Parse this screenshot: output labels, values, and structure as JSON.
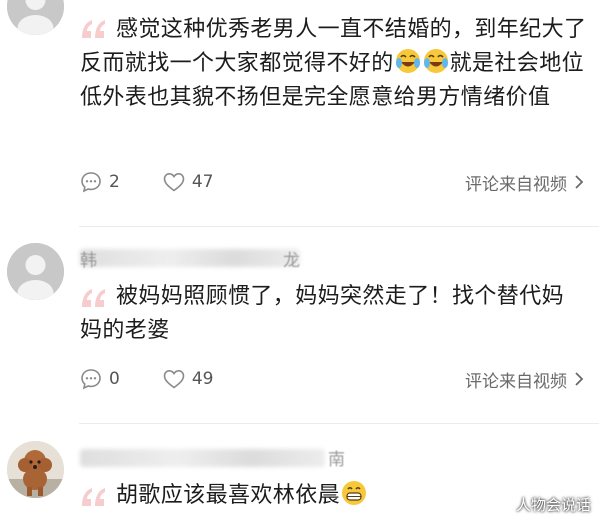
{
  "comments": [
    {
      "text": "感觉这种优秀老男人一直不结婚的，到年纪大了反而就找一个大家都觉得不好的",
      "text_after_emoji": "就是社会地位低外表也其貌不扬但是完全愿意给男方情绪价值",
      "reply_count": "2",
      "like_count": "47",
      "source": "评论来自视频"
    },
    {
      "name_first_char": "韩",
      "name_last_char": "龙",
      "text": "被妈妈照顾惯了，妈妈突然走了！找个替代妈妈的老婆",
      "reply_count": "0",
      "like_count": "49",
      "source": "评论来自视频"
    },
    {
      "name_last_char": "南",
      "text": "胡歌应该最喜欢林依晨"
    }
  ],
  "watermark": "人物会说话",
  "colors": {
    "quote": "#f5c9c9",
    "icon": "#8a8a8a",
    "emoji": "#f7c83a"
  }
}
